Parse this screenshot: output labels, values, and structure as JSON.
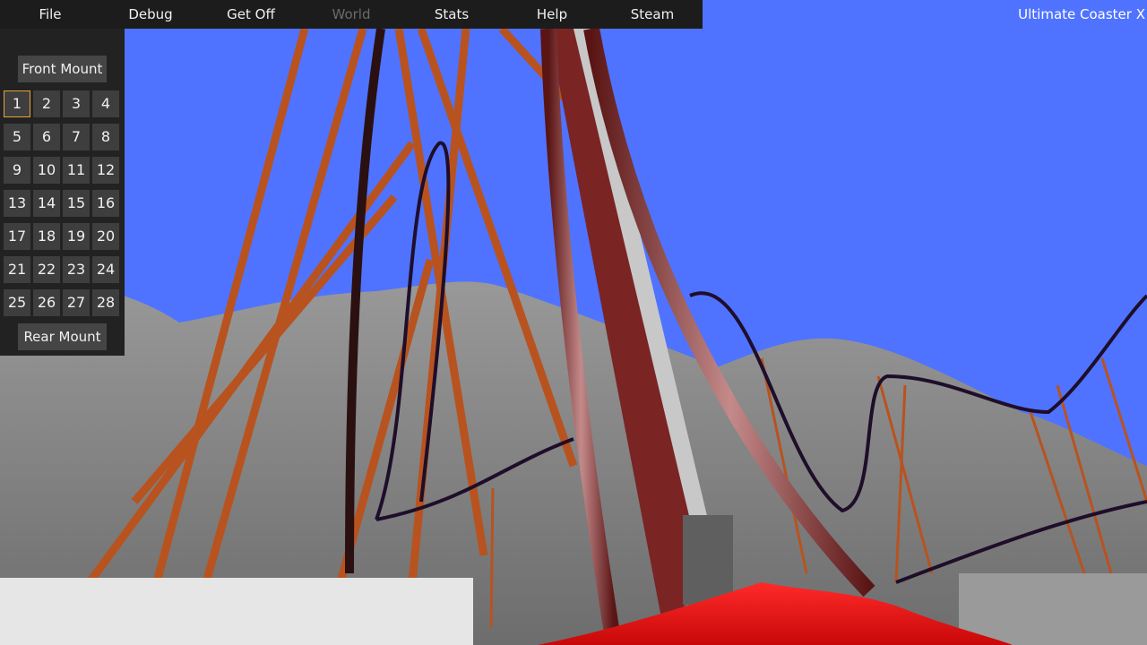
{
  "menu": {
    "items": [
      {
        "label": "File",
        "enabled": true
      },
      {
        "label": "Debug",
        "enabled": true
      },
      {
        "label": "Get Off",
        "enabled": true
      },
      {
        "label": "World",
        "enabled": false
      },
      {
        "label": "Stats",
        "enabled": true
      },
      {
        "label": "Help",
        "enabled": true
      },
      {
        "label": "Steam",
        "enabled": true
      }
    ]
  },
  "app_title": "Ultimate Coaster X",
  "panel": {
    "front_mount_label": "Front Mount",
    "rear_mount_label": "Rear Mount",
    "selected_seat": "1",
    "seats": [
      "1",
      "2",
      "3",
      "4",
      "5",
      "6",
      "7",
      "8",
      "9",
      "10",
      "11",
      "12",
      "13",
      "14",
      "15",
      "16",
      "17",
      "18",
      "19",
      "20",
      "21",
      "22",
      "23",
      "24",
      "25",
      "26",
      "27",
      "28"
    ]
  },
  "colors": {
    "sky": "#4f73ff",
    "menu_bg": "#1c1c1c",
    "panel_bg": "#222222",
    "button_bg": "#454545",
    "seat_bg": "#3e3e3e",
    "selected_border": "#e8a23a",
    "track_supports": "#b8531f",
    "track_rail": "#6e1d1d",
    "car": "#e81414",
    "terrain": "#8a8a8a"
  }
}
